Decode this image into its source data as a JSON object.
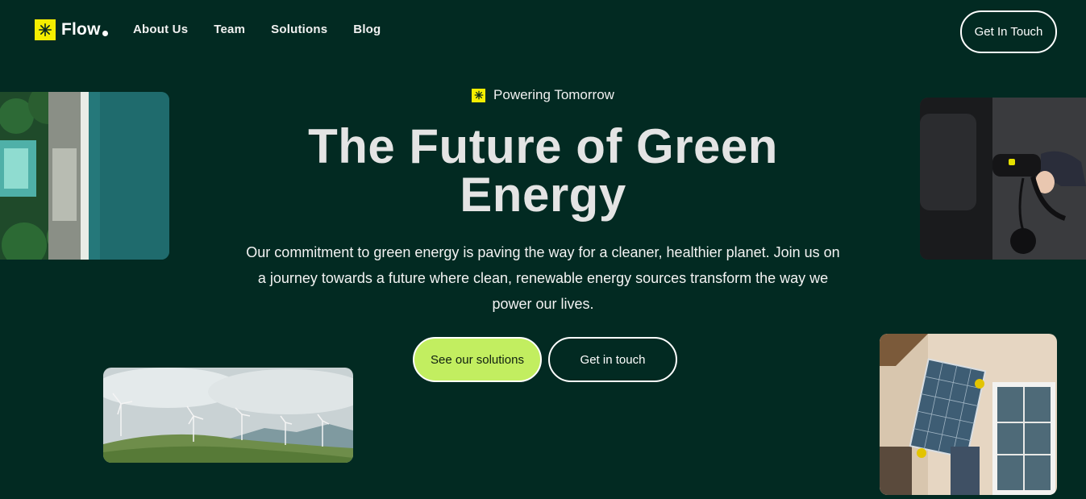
{
  "header": {
    "logo_text": "Flow",
    "logo_icon": "asterisk-icon",
    "nav": [
      {
        "label": "About Us"
      },
      {
        "label": "Team"
      },
      {
        "label": "Solutions"
      },
      {
        "label": "Blog"
      }
    ],
    "cta_label": "Get In Touch"
  },
  "hero": {
    "badge_icon": "asterisk-icon",
    "badge_text": "Powering Tomorrow",
    "title": "The Future of Green Energy",
    "description": "Our commitment to green energy is paving the way for a cleaner, healthier planet. Join us on a journey towards a future where clean, renewable energy sources transform the way we power our lives.",
    "primary_button": "See our solutions",
    "secondary_button": "Get in touch"
  },
  "colors": {
    "background": "#022a22",
    "accent_yellow": "#f4ee00",
    "button_green": "#c2ee60"
  }
}
